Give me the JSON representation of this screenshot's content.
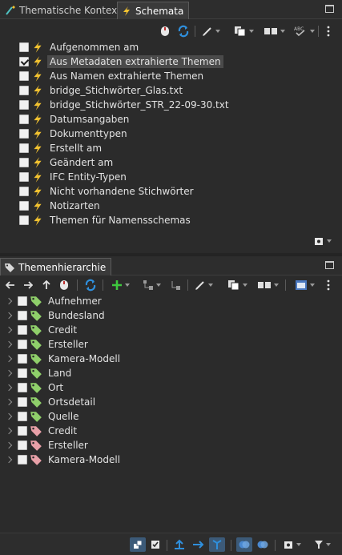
{
  "top_panel": {
    "tabs": [
      {
        "label": "Thematische Kontexte",
        "icon": "tag-wand-icon"
      },
      {
        "label": "Schemata",
        "icon": "lightning-icon"
      }
    ],
    "items": [
      {
        "label": "Aufgenommen am",
        "checked": false,
        "selected": false
      },
      {
        "label": "Aus Metadaten extrahierte Themen",
        "checked": true,
        "selected": true
      },
      {
        "label": "Aus Namen extrahierte Themen",
        "checked": false,
        "selected": false
      },
      {
        "label": "bridge_Stichwörter_Glas.txt",
        "checked": false,
        "selected": false
      },
      {
        "label": "bridge_Stichwörter_STR_22-09-30.txt",
        "checked": false,
        "selected": false
      },
      {
        "label": "Datumsangaben",
        "checked": false,
        "selected": false
      },
      {
        "label": "Dokumenttypen",
        "checked": false,
        "selected": false
      },
      {
        "label": "Erstellt am",
        "checked": false,
        "selected": false
      },
      {
        "label": "Geändert am",
        "checked": false,
        "selected": false
      },
      {
        "label": "IFC Entity-Typen",
        "checked": false,
        "selected": false
      },
      {
        "label": "Nicht vorhandene Stichwörter",
        "checked": false,
        "selected": false
      },
      {
        "label": "Notizarten",
        "checked": false,
        "selected": false
      },
      {
        "label": "Themen für Namensschemas",
        "checked": false,
        "selected": false
      }
    ]
  },
  "bottom_panel": {
    "tab_label": "Themenhierarchie",
    "items": [
      {
        "label": "Aufnehmer",
        "tag_color": "#8fcf6a"
      },
      {
        "label": "Bundesland",
        "tag_color": "#8fcf6a"
      },
      {
        "label": "Credit",
        "tag_color": "#8fcf6a"
      },
      {
        "label": "Ersteller",
        "tag_color": "#8fcf6a"
      },
      {
        "label": "Kamera-Modell",
        "tag_color": "#8fcf6a"
      },
      {
        "label": "Land",
        "tag_color": "#8fcf6a"
      },
      {
        "label": "Ort",
        "tag_color": "#8fcf6a"
      },
      {
        "label": "Ortsdetail",
        "tag_color": "#8fcf6a"
      },
      {
        "label": "Quelle",
        "tag_color": "#8fcf6a"
      },
      {
        "label": "Credit",
        "tag_color": "#e8a0a8"
      },
      {
        "label": "Ersteller",
        "tag_color": "#e8a0a8"
      },
      {
        "label": "Kamera-Modell",
        "tag_color": "#e8a0a8"
      }
    ]
  },
  "colors": {
    "background": "#2b2b2b",
    "accent_blue": "#2f8fdc",
    "add_green": "#3ec93e",
    "lightning_yellow": "#f2c230"
  }
}
